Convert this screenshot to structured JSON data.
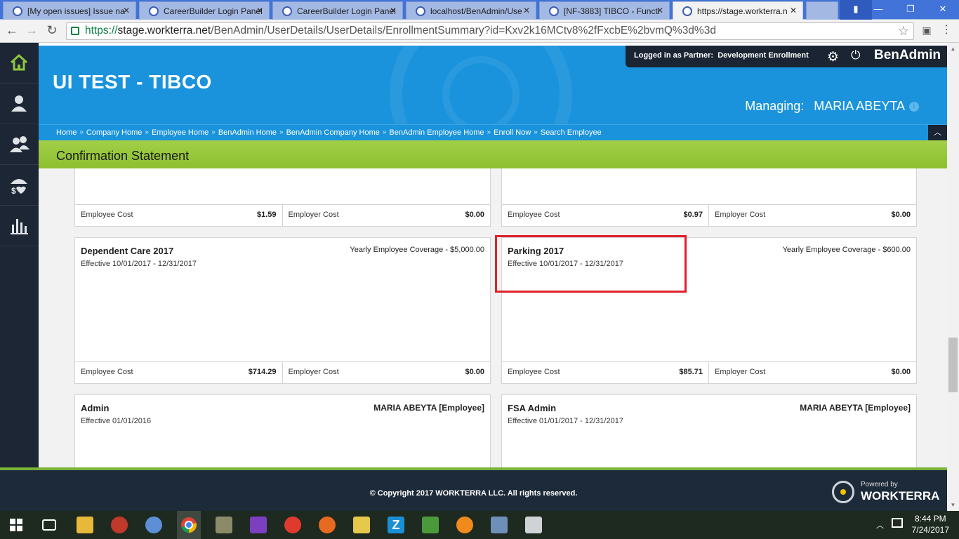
{
  "browser": {
    "tabs": [
      {
        "title": "[My open issues] Issue na"
      },
      {
        "title": "CareerBuilder Login Panel"
      },
      {
        "title": "CareerBuilder Login Panel"
      },
      {
        "title": "localhost/BenAdmin/Use"
      },
      {
        "title": "[NF-3883] TIBCO - Functi"
      },
      {
        "title": "https://stage.workterra.n"
      }
    ],
    "url_scheme": "https://",
    "url_host": "stage.workterra.net",
    "url_path": "/BenAdmin/UserDetails/UserDetails/EnrollmentSummary?id=Kxv2k16MCtv8%2fFxcbE%2bvmQ%3d%3d"
  },
  "header": {
    "title": "UI TEST - TIBCO",
    "logged_in_prefix": "Logged in as",
    "partner_label": "Partner:",
    "partner_value": "Development Enrollment",
    "brand": "BenAdmin",
    "managing_label": "Managing:",
    "managing_value": "MARIA ABEYTA"
  },
  "breadcrumb": [
    "Home",
    "Company Home",
    "Employee Home",
    "BenAdmin Home",
    "BenAdmin Company Home",
    "BenAdmin Employee Home",
    "Enroll Now",
    "Search Employee"
  ],
  "breadcrumb_separator": "»",
  "page_title": "Confirmation Statement",
  "cost_labels": {
    "employee": "Employee Cost",
    "employer": "Employer Cost"
  },
  "cards": [
    {
      "name": "",
      "effective": "",
      "coverage": "",
      "employee_cost": "$1.59",
      "employer_cost": "$0.00"
    },
    {
      "name": "",
      "effective": "",
      "coverage": "",
      "employee_cost": "$0.97",
      "employer_cost": "$0.00"
    },
    {
      "name": "Dependent Care 2017",
      "effective": "Effective 10/01/2017 - 12/31/2017",
      "coverage": "Yearly Employee Coverage - $5,000.00",
      "employee_cost": "$714.29",
      "employer_cost": "$0.00"
    },
    {
      "name": "Parking 2017",
      "effective": "Effective 10/01/2017 - 12/31/2017",
      "coverage": "Yearly Employee Coverage - $600.00",
      "employee_cost": "$85.71",
      "employer_cost": "$0.00"
    },
    {
      "name": "Admin",
      "effective": "Effective 01/01/2016",
      "coverage": "MARIA ABEYTA [Employee]"
    },
    {
      "name": "FSA Admin",
      "effective": "Effective 01/01/2017 - 12/31/2017",
      "coverage": "MARIA ABEYTA [Employee]"
    }
  ],
  "footer": {
    "copyright": "© Copyright 2017 WORKTERRA LLC. All rights reserved.",
    "powered_by": "Powered by",
    "powered_brand": "WORKTERRA"
  },
  "taskbar": {
    "time": "8:44 PM",
    "date": "7/24/2017"
  },
  "colors": {
    "header_blue": "#1a93dc",
    "title_green": "#8dbf30",
    "sidebar": "#1d2634",
    "highlight": "#e0202a"
  }
}
